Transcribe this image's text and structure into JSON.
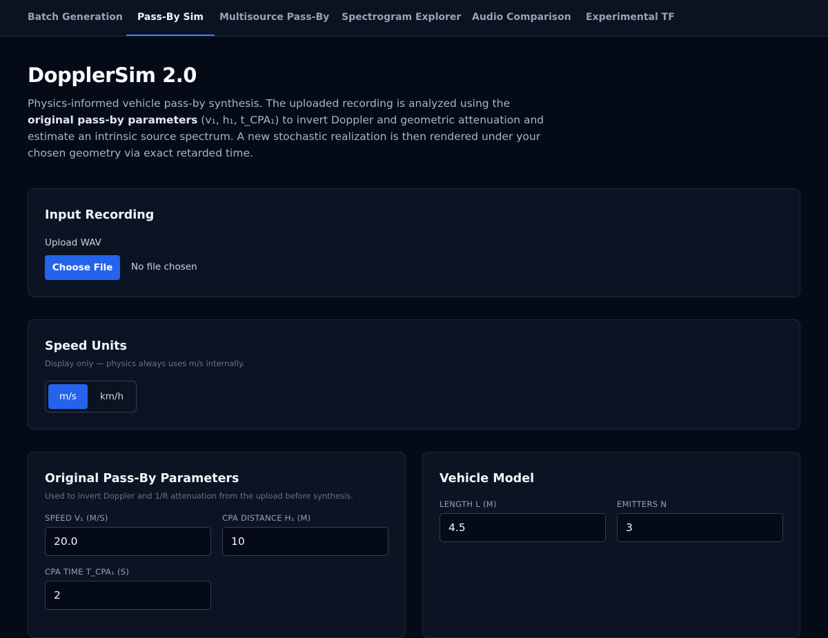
{
  "tabs": [
    {
      "label": "Batch Generation"
    },
    {
      "label": "Pass-By Sim"
    },
    {
      "label": "Multisource Pass-By"
    },
    {
      "label": "Spectrogram Explorer"
    },
    {
      "label": "Audio Comparison"
    },
    {
      "label": "Experimental TF"
    }
  ],
  "page": {
    "title": "DopplerSim 2.0",
    "desc_a": "Physics-informed vehicle pass-by synthesis. The uploaded recording is analyzed using the ",
    "desc_bold": "original pass-by parameters",
    "desc_b": " (v₁, h₁, t_CPA₁) to invert Doppler and geometric attenuation and estimate an intrinsic source spectrum. A new stochastic realization is then rendered under your chosen geometry via exact retarded time."
  },
  "input_recording": {
    "title": "Input Recording",
    "upload_label": "Upload WAV",
    "button": "Choose File",
    "status": "No file chosen"
  },
  "speed_units": {
    "title": "Speed Units",
    "hint": "Display only — physics always uses m/s internally.",
    "options": [
      "m/s",
      "km/h"
    ],
    "selected": "m/s"
  },
  "original": {
    "title": "Original Pass-By Parameters",
    "hint": "Used to invert Doppler and 1/R attenuation from the upload before synthesis.",
    "speed_label": "SPEED V₁ (M/S)",
    "speed_value": "20.0",
    "cpa_dist_label": "CPA DISTANCE H₁ (M)",
    "cpa_dist_value": "10",
    "cpa_time_label": "CPA TIME T_CPA₁ (S)",
    "cpa_time_value": "2"
  },
  "vehicle": {
    "title": "Vehicle Model",
    "length_label": "LENGTH L (M)",
    "length_value": "4.5",
    "emitters_label": "EMITTERS N",
    "emitters_value": "3"
  },
  "colors": {
    "accent": "#2563eb",
    "background": "#050a17",
    "card": "#0c1322"
  }
}
